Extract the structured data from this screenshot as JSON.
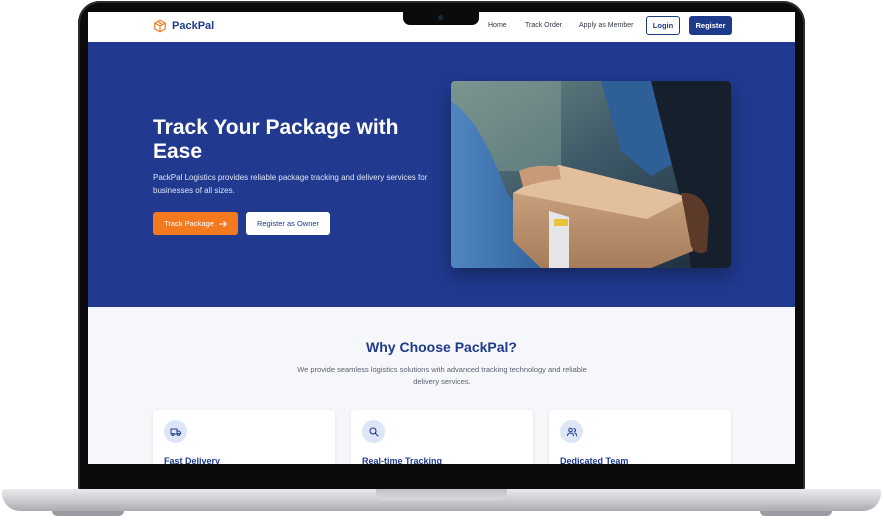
{
  "nav": {
    "brand": "PackPal",
    "links": [
      "Home",
      "Track Order",
      "Apply as Member"
    ],
    "login_label": "Login",
    "register_label": "Register"
  },
  "hero": {
    "title": "Track Your Package with Ease",
    "subtitle": "PackPal Logistics provides reliable package tracking and delivery services for businesses of all sizes.",
    "track_button_label": "Track Package",
    "owner_button_label": "Register as Owner"
  },
  "why": {
    "title": "Why Choose PackPal?",
    "subtitle": "We provide seamless logistics solutions with advanced tracking technology and reliable delivery services.",
    "cards": [
      {
        "title": "Fast Delivery",
        "icon": "truck-icon"
      },
      {
        "title": "Real-time Tracking",
        "icon": "search-icon"
      },
      {
        "title": "Dedicated Team",
        "icon": "users-icon"
      }
    ]
  },
  "colors": {
    "primary": "#1e3a8a",
    "hero_background": "#213a90",
    "accent": "#f47a20"
  }
}
